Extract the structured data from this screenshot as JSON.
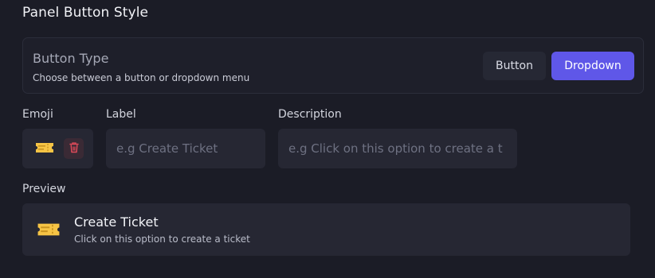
{
  "panel": {
    "title": "Panel Button Style"
  },
  "button_type": {
    "heading": "Button Type",
    "description": "Choose between a button or dropdown menu",
    "options": [
      "Button",
      "Dropdown"
    ],
    "selected": "Dropdown"
  },
  "fields": {
    "emoji_label": "Emoji",
    "emoji_icon": "ticket-icon",
    "label_label": "Label",
    "label_placeholder": "e.g Create Ticket",
    "description_label": "Description",
    "description_placeholder": "e.g Click on this option to create a t"
  },
  "preview": {
    "label": "Preview",
    "icon": "ticket-icon",
    "title": "Create Ticket",
    "description": "Click on this option to create a ticket"
  },
  "colors": {
    "background": "#1b1c26",
    "accent": "#5f57e8",
    "ticket": "#f6c445",
    "trash": "#e04a5a"
  }
}
